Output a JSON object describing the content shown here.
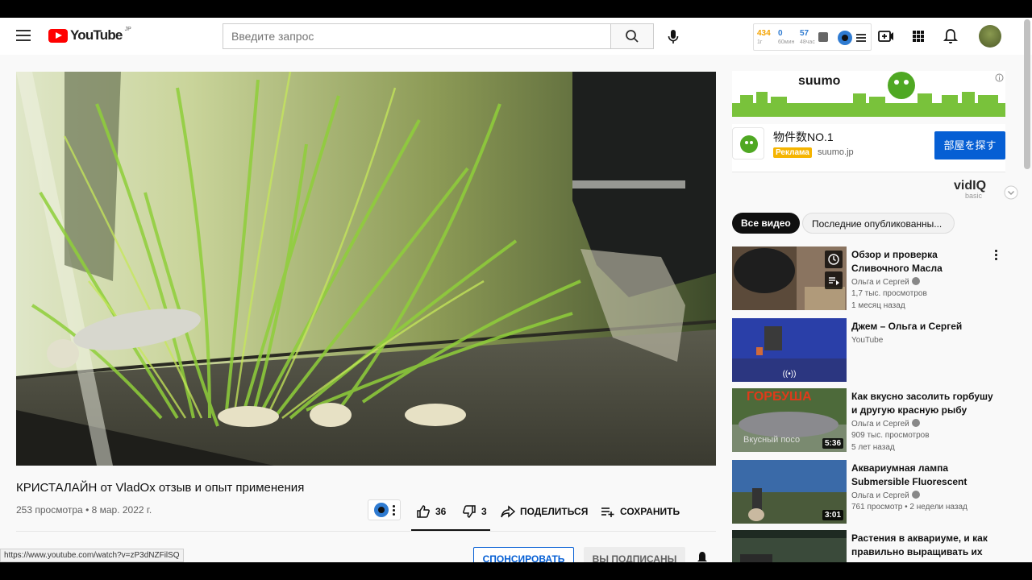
{
  "header": {
    "logo_text": "YouTube",
    "logo_region": "JP",
    "search_placeholder": "Введите запрос",
    "vidiq_stats": [
      {
        "value": "434",
        "label": "1г",
        "color": "#f4a300"
      },
      {
        "value": "0",
        "label": "60мин",
        "color": "#2f7bd1"
      },
      {
        "value": "57",
        "label": "48час",
        "color": "#2f7bd1"
      }
    ]
  },
  "video": {
    "title": "КРИСТАЛАЙН от VladOx отзыв и опыт применения",
    "views": "253 просмотра",
    "separator": "•",
    "date": "8 мар. 2022 г.",
    "likes": "36",
    "dislikes": "3",
    "share_label": "ПОДЕЛИТЬСЯ",
    "save_label": "СОХРАНИТЬ",
    "sponsor_label": "СПОНСИРОВАТЬ",
    "subscribed_label": "ВЫ ПОДПИСАНЫ"
  },
  "status_url": "https://www.youtube.com/watch?v=zP3dNZFilSQ",
  "ad": {
    "banner_brand": "suumo",
    "title": "物件数NO.1",
    "badge": "Реклама",
    "domain": "suumo.jp",
    "cta": "部屋を探す"
  },
  "vidiq_panel": {
    "logo": "vidIQ",
    "plan": "basic"
  },
  "chips": {
    "active": "Все видео",
    "inactive": "Последние опубликованны..."
  },
  "recommendations": [
    {
      "title": "Обзор и проверка Сливочного Масла",
      "channel": "Ольга и Сергей",
      "views": "1,7 тыс. просмотров",
      "age": "1 месяц назад",
      "duration": ""
    },
    {
      "title": "Джем – Ольга и Сергей",
      "channel": "YouTube",
      "views": "",
      "age": "",
      "duration": ""
    },
    {
      "title": "Как вкусно засолить горбушу и другую красную рыбу",
      "channel": "Ольга и Сергей",
      "views": "909 тыс. просмотров",
      "age": "5 лет назад",
      "duration": "5:36",
      "thumb_text": "ГОРБУША",
      "thumb_sub": "Вкусный посо"
    },
    {
      "title": "Аквариумная лампа Submersible Fluorescent Lamp",
      "channel": "Ольга и Сергей",
      "views": "761 просмотр",
      "age": "2 недели назад",
      "duration": "3:01"
    },
    {
      "title": "Растения в аквариуме, и как правильно выращивать их в...",
      "channel": "",
      "views": "",
      "age": "",
      "duration": ""
    }
  ]
}
